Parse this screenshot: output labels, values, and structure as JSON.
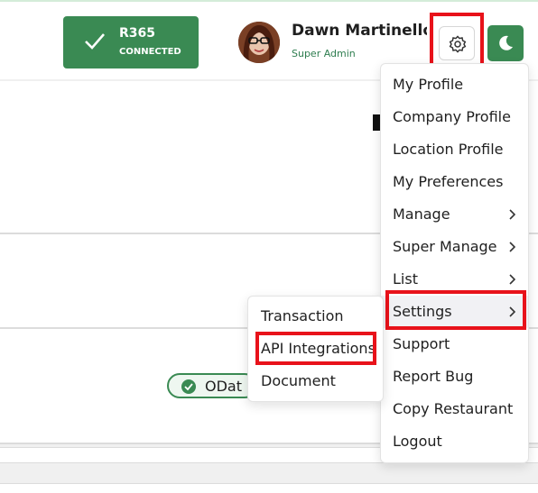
{
  "header": {
    "r365_badge": {
      "title": "R365",
      "status": "CONNECTED",
      "color": "#3a8a53"
    },
    "user": {
      "name": "Dawn Martinello",
      "role": "Super Admin",
      "avatar_icon": "user-avatar-photo"
    },
    "settings_icon": "gear-icon",
    "theme_icon": "moon-icon"
  },
  "content": {
    "chip_label": "ODat"
  },
  "settings_menu": {
    "items": [
      {
        "label": "My Profile",
        "has_submenu": false
      },
      {
        "label": "Company Profile",
        "has_submenu": false
      },
      {
        "label": "Location Profile",
        "has_submenu": false
      },
      {
        "label": "My Preferences",
        "has_submenu": false
      },
      {
        "label": "Manage",
        "has_submenu": true
      },
      {
        "label": "Super Manage",
        "has_submenu": true
      },
      {
        "label": "List",
        "has_submenu": true
      },
      {
        "label": "Settings",
        "has_submenu": true,
        "active": true
      },
      {
        "label": "Support",
        "has_submenu": false
      },
      {
        "label": "Report Bug",
        "has_submenu": false
      },
      {
        "label": "Copy Restaurant",
        "has_submenu": false
      },
      {
        "label": "Logout",
        "has_submenu": false
      }
    ]
  },
  "settings_submenu": {
    "items": [
      {
        "label": "Transaction"
      },
      {
        "label": "API Integrations",
        "highlighted": true
      },
      {
        "label": "Document"
      }
    ]
  },
  "colors": {
    "accent": "#3a8a53",
    "highlight": "#e8121a"
  }
}
